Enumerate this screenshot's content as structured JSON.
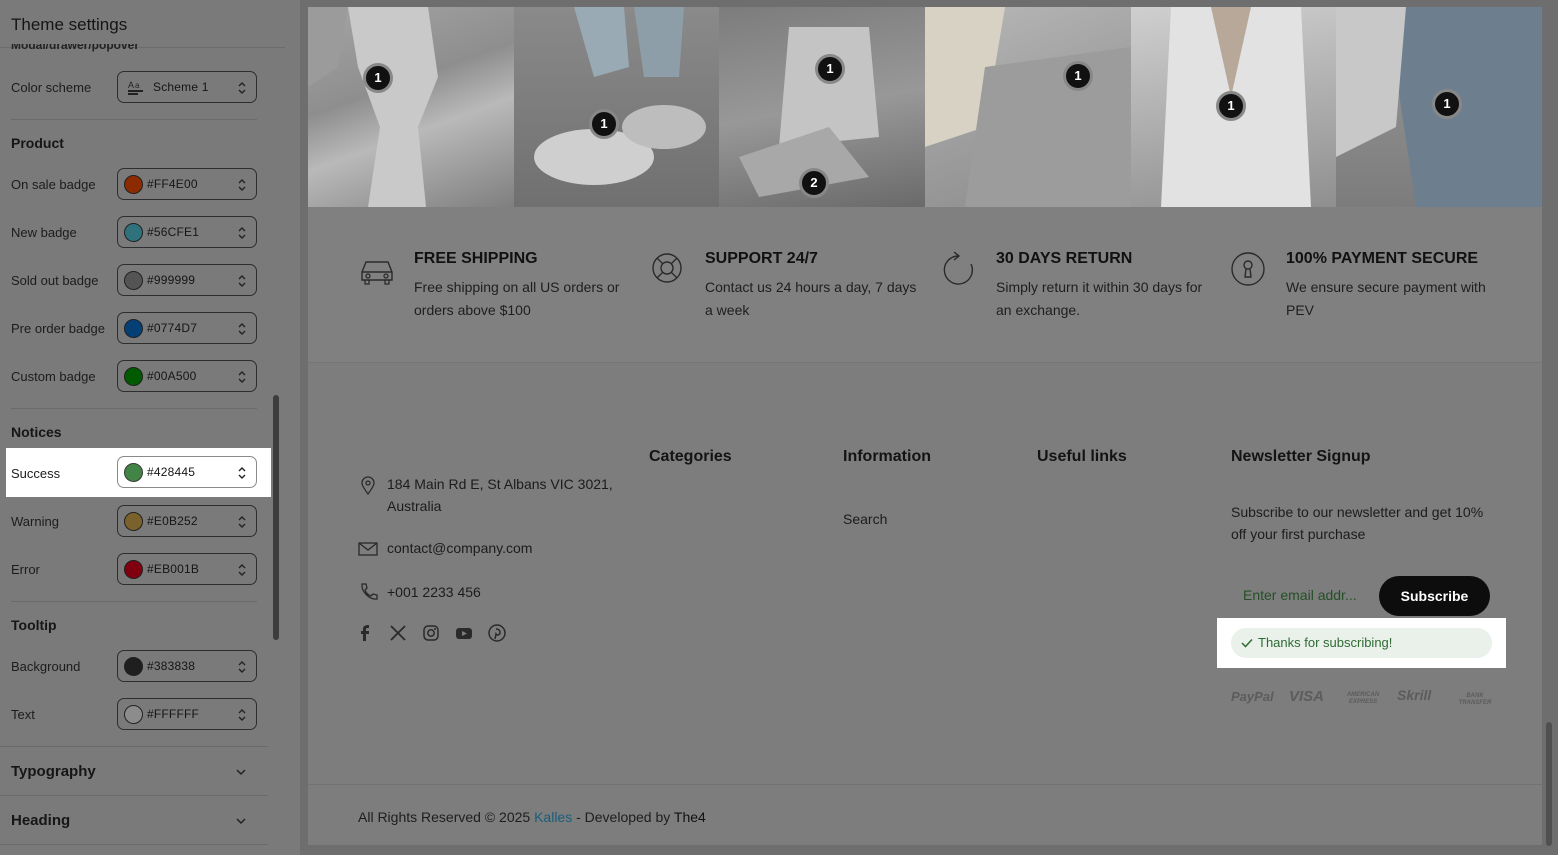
{
  "sidebar": {
    "title": "Theme settings",
    "cut_label": "Modal/drawer/popover",
    "color_scheme": {
      "label": "Color scheme",
      "value": "Scheme 1"
    },
    "product": {
      "title": "Product",
      "rows": [
        {
          "label": "On sale badge",
          "hex": "#FF4E00",
          "color": "#FF4E00"
        },
        {
          "label": "New badge",
          "hex": "#56CFE1",
          "color": "#56CFE1"
        },
        {
          "label": "Sold out badge",
          "hex": "#999999",
          "color": "#999999"
        },
        {
          "label": "Pre order badge",
          "hex": "#0774D7",
          "color": "#0774D7"
        },
        {
          "label": "Custom badge",
          "hex": "#00A500",
          "color": "#00A500"
        }
      ]
    },
    "notices": {
      "title": "Notices",
      "rows": [
        {
          "label": "Success",
          "hex": "#428445",
          "color": "#428445"
        },
        {
          "label": "Warning",
          "hex": "#E0B252",
          "color": "#E0B252"
        },
        {
          "label": "Error",
          "hex": "#EB001B",
          "color": "#EB001B"
        }
      ]
    },
    "tooltip": {
      "title": "Tooltip",
      "rows": [
        {
          "label": "Background",
          "hex": "#383838",
          "color": "#383838"
        },
        {
          "label": "Text",
          "hex": "#FFFFFF",
          "color": "#FFFFFF"
        }
      ]
    },
    "typography": {
      "title": "Typography"
    },
    "heading": {
      "title": "Heading"
    }
  },
  "gallery": {
    "hotspots": [
      "1",
      "1",
      "1",
      "2",
      "1",
      "1",
      "1"
    ]
  },
  "features": [
    {
      "title": "FREE SHIPPING",
      "text": "Free shipping on all US orders or orders above $100",
      "icon": "car-icon"
    },
    {
      "title": "SUPPORT 24/7",
      "text": "Contact us 24 hours a day, 7 days a week",
      "icon": "lifebuoy-icon"
    },
    {
      "title": "30 DAYS RETURN",
      "text": "Simply return it within 30 days for an exchange.",
      "icon": "refresh-icon"
    },
    {
      "title": "100% PAYMENT SECURE",
      "text": "We ensure secure payment with PEV",
      "icon": "keyhole-icon"
    }
  ],
  "footer": {
    "address": "184 Main Rd E, St Albans VIC 3021, Australia",
    "email": "contact@company.com",
    "phone": "+001 2233 456",
    "columns": {
      "categories": "Categories",
      "information": "Information",
      "useful_links": "Useful links",
      "newsletter": "Newsletter Signup"
    },
    "information_links": [
      "Search"
    ],
    "newsletter_text": "Subscribe to our newsletter and get 10% off your first purchase",
    "email_placeholder": "Enter email addr...",
    "subscribe_label": "Subscribe",
    "success_message": "Thanks for subscribing!",
    "payments": [
      "PayPal",
      "VISA",
      "AMERICAN EXPRESS",
      "Skrill",
      "BANK TRANSFER"
    ]
  },
  "bottom": {
    "copy_prefix": "All Rights Reserved © 2025 ",
    "brand": "Kalles",
    "copy_mid": " - Developed by ",
    "developer": "The4"
  }
}
